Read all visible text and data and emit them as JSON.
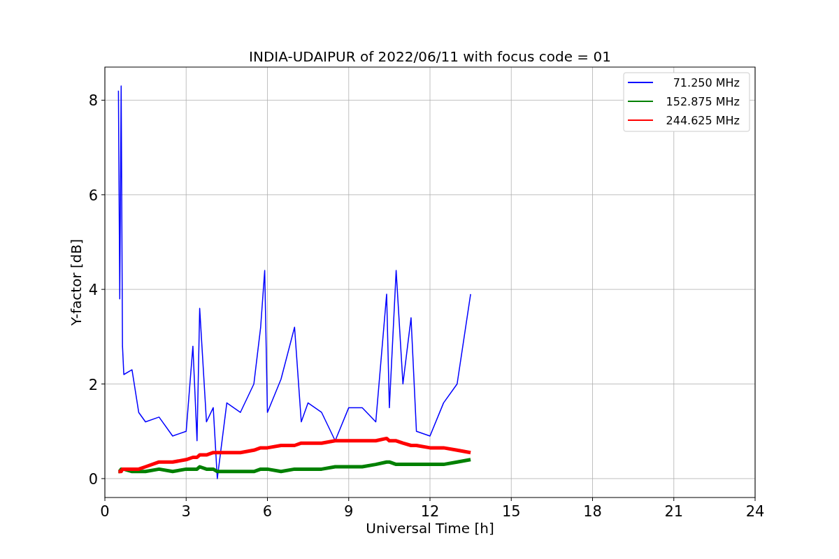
{
  "chart_data": {
    "type": "line",
    "title": "INDIA-UDAIPUR of 2022/06/11 with focus code = 01",
    "xlabel": "Universal Time [h]",
    "ylabel": "Y-factor [dB]",
    "x": [
      0.5,
      0.55,
      0.6,
      0.65,
      0.7,
      1.0,
      1.25,
      1.5,
      2.0,
      2.5,
      3.0,
      3.25,
      3.4,
      3.5,
      3.75,
      4.0,
      4.15,
      4.5,
      5.0,
      5.5,
      5.75,
      5.9,
      6.0,
      6.5,
      7.0,
      7.25,
      7.5,
      8.0,
      8.5,
      9.0,
      9.5,
      10.0,
      10.4,
      10.5,
      10.75,
      11.0,
      11.3,
      11.5,
      12.0,
      12.5,
      13.0,
      13.5
    ],
    "series": [
      {
        "name": "71.250 MHz",
        "color": "#0000ff",
        "values": [
          8.2,
          3.8,
          8.3,
          2.8,
          2.2,
          2.3,
          1.4,
          1.2,
          1.3,
          0.9,
          1.0,
          2.8,
          0.8,
          3.6,
          1.2,
          1.5,
          0.0,
          1.6,
          1.4,
          2.0,
          3.2,
          4.4,
          1.4,
          2.1,
          3.2,
          1.2,
          1.6,
          1.4,
          0.8,
          1.5,
          1.5,
          1.2,
          3.9,
          1.5,
          4.4,
          2.0,
          3.4,
          1.0,
          0.9,
          1.6,
          2.0,
          3.9
        ]
      },
      {
        "name": "152.875 MHz",
        "color": "#008000",
        "values": [
          0.15,
          0.15,
          0.2,
          0.2,
          0.2,
          0.15,
          0.15,
          0.15,
          0.2,
          0.15,
          0.2,
          0.2,
          0.2,
          0.25,
          0.2,
          0.2,
          0.15,
          0.15,
          0.15,
          0.15,
          0.2,
          0.2,
          0.2,
          0.15,
          0.2,
          0.2,
          0.2,
          0.2,
          0.25,
          0.25,
          0.25,
          0.3,
          0.35,
          0.35,
          0.3,
          0.3,
          0.3,
          0.3,
          0.3,
          0.3,
          0.35,
          0.4
        ]
      },
      {
        "name": "244.625 MHz",
        "color": "#ff0000",
        "values": [
          0.15,
          0.15,
          0.15,
          0.2,
          0.2,
          0.2,
          0.2,
          0.25,
          0.35,
          0.35,
          0.4,
          0.45,
          0.45,
          0.5,
          0.5,
          0.55,
          0.55,
          0.55,
          0.55,
          0.6,
          0.65,
          0.65,
          0.65,
          0.7,
          0.7,
          0.75,
          0.75,
          0.75,
          0.8,
          0.8,
          0.8,
          0.8,
          0.85,
          0.8,
          0.8,
          0.75,
          0.7,
          0.7,
          0.65,
          0.65,
          0.6,
          0.55
        ]
      }
    ],
    "grid": true,
    "legend": true,
    "xlim": [
      0,
      24
    ],
    "ylim": [
      -0.4,
      8.7
    ],
    "xticks": [
      0,
      3,
      6,
      9,
      12,
      15,
      18,
      21,
      24
    ],
    "yticks": [
      0,
      2,
      4,
      6,
      8
    ]
  }
}
